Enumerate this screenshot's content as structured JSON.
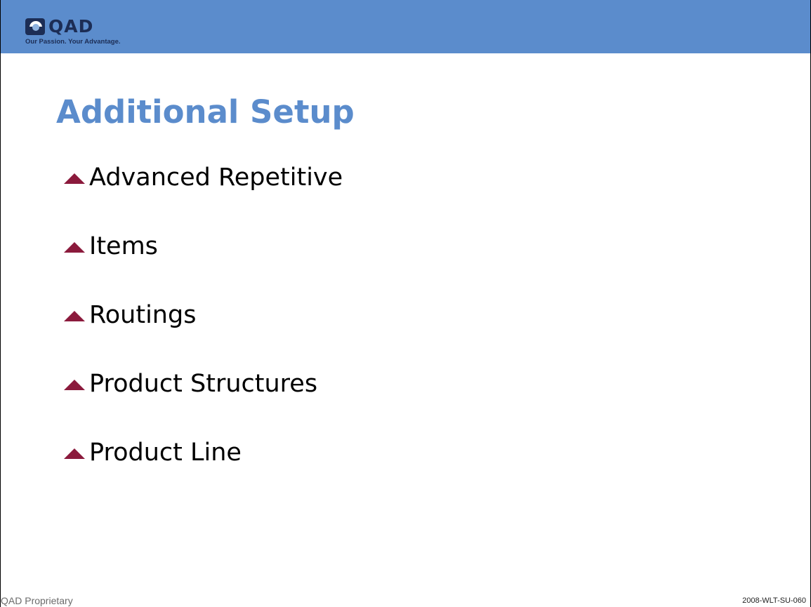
{
  "logo": {
    "wordmark": "QAD",
    "tagline": "Our Passion. Your Advantage.",
    "icon": "qad-logo-icon"
  },
  "slide": {
    "title": "Additional Setup",
    "bullet_icon": "triangle-up-icon",
    "bullet_color": "#8b1a3c",
    "title_color": "#5b8ccc",
    "header_color": "#5b8ccc",
    "bullets": [
      {
        "label": "Advanced Repetitive"
      },
      {
        "label": "Items"
      },
      {
        "label": "Routings"
      },
      {
        "label": "Product Structures"
      },
      {
        "label": "Product Line"
      }
    ]
  },
  "footer": {
    "left": "QAD Proprietary",
    "right": "2008-WLT-SU-060"
  }
}
